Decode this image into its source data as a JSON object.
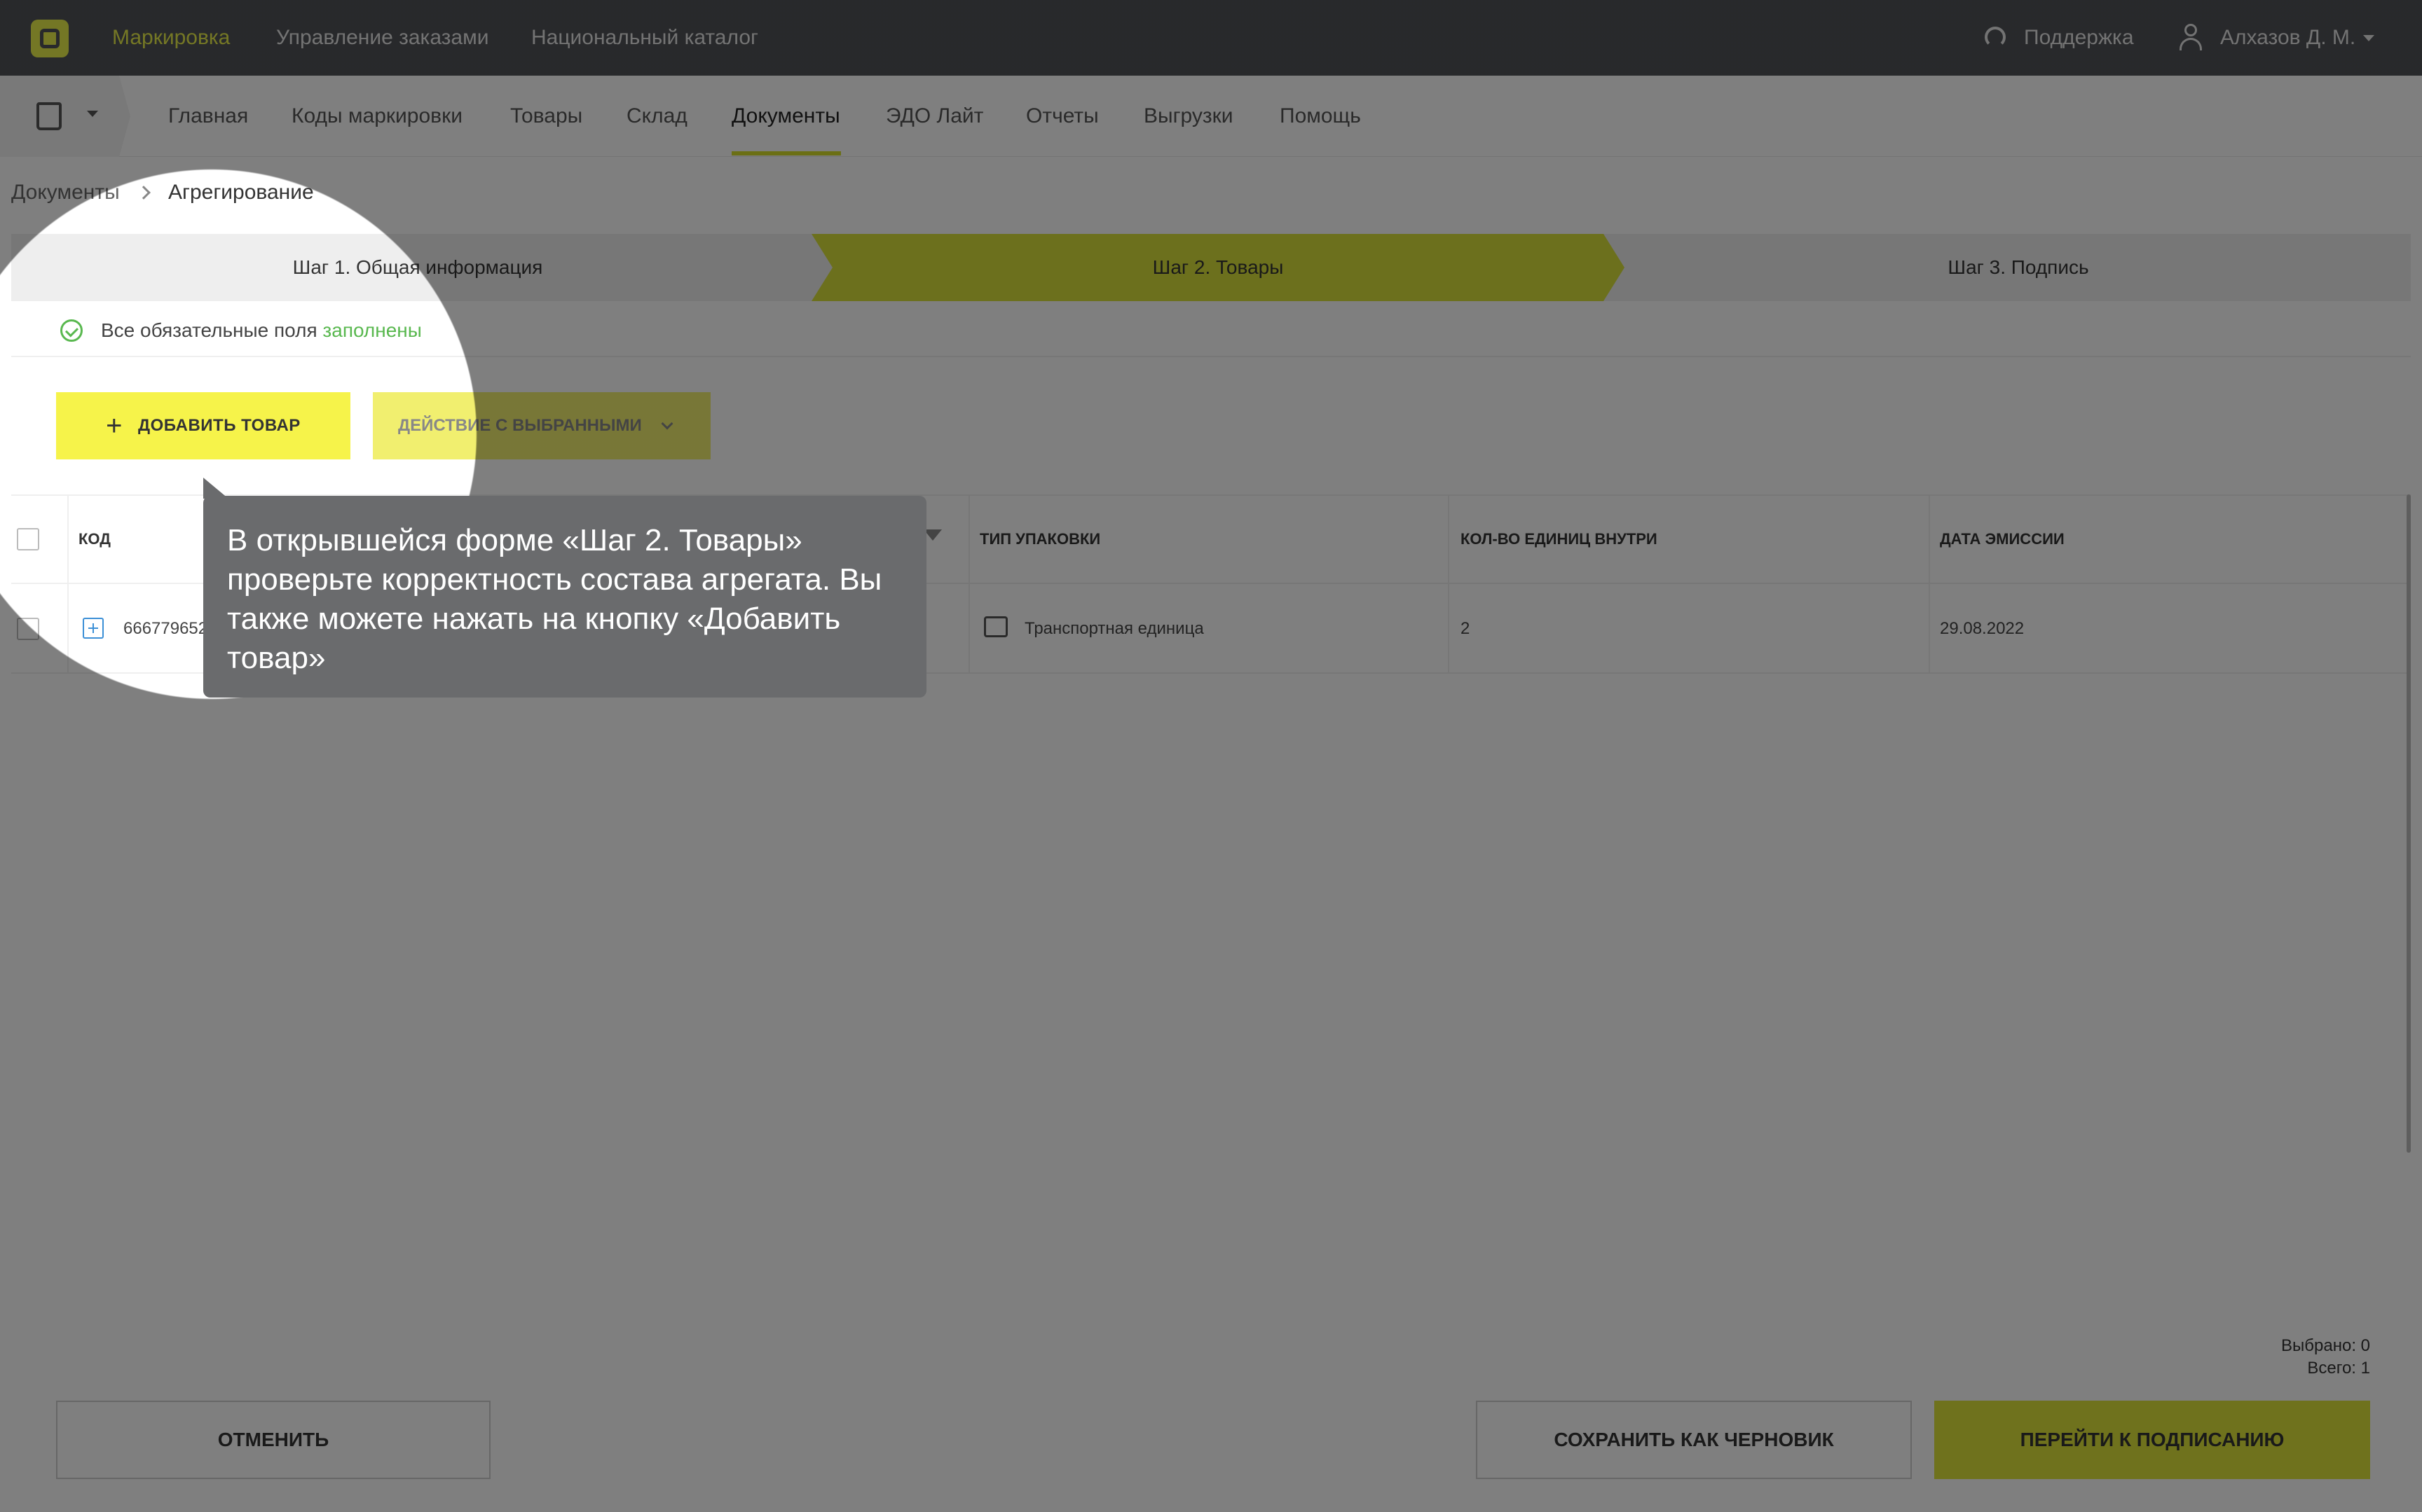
{
  "topbar": {
    "nav": [
      "Маркировка",
      "Управление заказами",
      "Национальный каталог"
    ],
    "support": "Поддержка",
    "user": "Алхазов Д. М."
  },
  "subnav": [
    "Главная",
    "Коды маркировки",
    "Товары",
    "Склад",
    "Документы",
    "ЭДО Лайт",
    "Отчеты",
    "Выгрузки",
    "Помощь"
  ],
  "breadcrumb": {
    "parent": "Документы",
    "current": "Агрегирование"
  },
  "steps": [
    "Шаг 1. Общая информация",
    "Шаг 2. Товары",
    "Шаг 3. Подпись"
  ],
  "required": {
    "text": "Все обязательные поля",
    "status": "заполнены"
  },
  "buttons": {
    "add": "ДОБАВИТЬ ТОВАР",
    "action": "ДЕЙСТВИЕ С ВЫБРАННЫМИ",
    "cancel": "ОТМЕНИТЬ",
    "draft": "СОХРАНИТЬ КАК ЧЕРНОВИК",
    "sign": "ПЕРЕЙТИ К ПОДПИСАНИЮ"
  },
  "table": {
    "headers": [
      "КОД",
      "ТИП УПАКОВКИ",
      "КОЛ-ВО ЕДИНИЦ ВНУТРИ",
      "ДАТА ЭМИССИИ"
    ],
    "row": {
      "code": "666779652",
      "pack": "Транспортная единица",
      "count": "2",
      "date": "29.08.2022"
    }
  },
  "totals": {
    "selected": "Выбрано: 0",
    "total": "Всего: 1"
  },
  "tooltip": "В открывшейся форме «Шаг 2. Товары» проверьте корректность состава агрегата. Вы также можете нажать на кнопку «Добавить товар»",
  "colors": {
    "accent": "#e9ef4a",
    "topbar": "#505257",
    "success": "#59b84f"
  }
}
